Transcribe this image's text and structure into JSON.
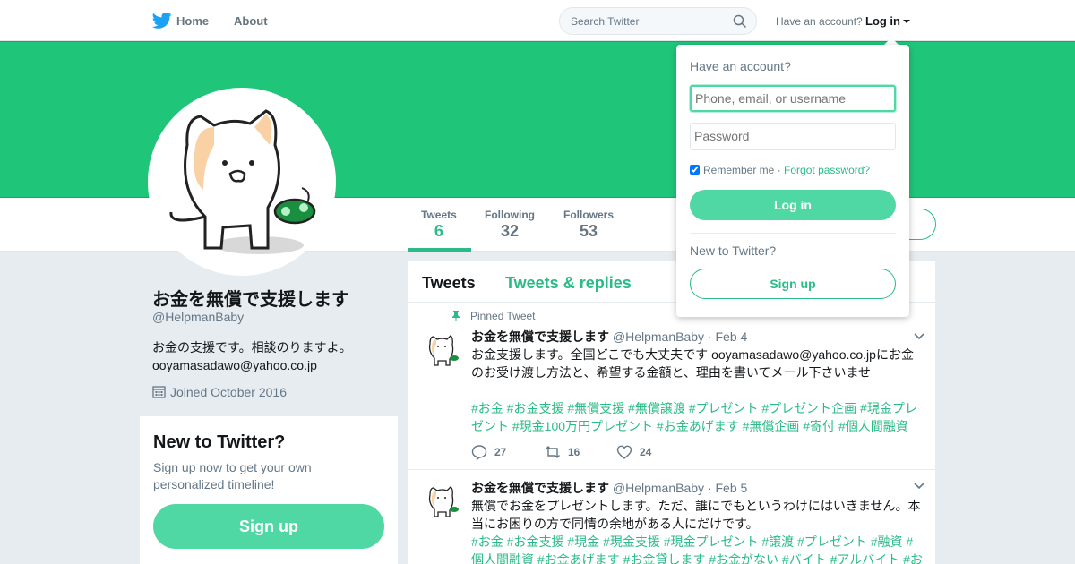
{
  "nav": {
    "home": "Home",
    "about": "About",
    "search_placeholder": "Search Twitter",
    "have_account": "Have an account?",
    "login": "Log in"
  },
  "profile_nav": {
    "stats": [
      {
        "label": "Tweets",
        "value": "6"
      },
      {
        "label": "Following",
        "value": "32"
      },
      {
        "label": "Followers",
        "value": "53"
      }
    ]
  },
  "profile": {
    "name": "お金を無償で支援します",
    "handle": "@HelpmanBaby",
    "bio_line1": "お金の支援です。相談のりますよ。",
    "bio_line2": "ooyamasadawo@yahoo.co.jp",
    "joined": "Joined October 2016"
  },
  "new_to_twitter": {
    "title": "New to Twitter?",
    "text": "Sign up now to get your own personalized timeline!",
    "button": "Sign up"
  },
  "timeline": {
    "tabs": [
      "Tweets",
      "Tweets & replies"
    ],
    "tweets": [
      {
        "pinned_label": "Pinned Tweet",
        "name": "お金を無償で支援します",
        "handle": "@HelpmanBaby",
        "date": "· Feb 4",
        "body": "お金支援します。全国どこでも大丈夫です ooyamasadawo@yahoo.co.jpにお金のお受け渡し方法と、希望する金額と、理由を書いてメール下さいませ",
        "tags": "#お金 #お金支援 #無償支援 #無償譲渡 #プレゼント #プレゼント企画 #現金プレゼント #現金100万円プレゼント #お金あげます #無償企画 #寄付 #個人間融資",
        "replies": "27",
        "retweets": "16",
        "likes": "24"
      },
      {
        "name": "お金を無償で支援します",
        "handle": "@HelpmanBaby",
        "date": "· Feb 5",
        "body": "無償でお金をプレゼントします。ただ、誰にでもというわけにはいきません。本当にお困りの方で同情の余地がある人にだけです。",
        "tags": "#お金 #お金支援 #現金 #現金支援 #現金プレゼント #譲渡 #プレゼント #融資 #個人間融資 #お金あげます #お金貸します #お金がない #バイト #アルバイト #お"
      }
    ]
  },
  "login_dropdown": {
    "title": "Have an account?",
    "username_placeholder": "Phone, email, or username",
    "password_placeholder": "Password",
    "remember": "Remember me",
    "separator": "·",
    "forgot": "Forgot password?",
    "login_button": "Log in",
    "new_label": "New to Twitter?",
    "signup_button": "Sign up"
  },
  "colors": {
    "accent": "#2abb87",
    "banner": "#1fc67a",
    "button_fill": "#4fd8a4",
    "bird": "#1da1f2"
  }
}
